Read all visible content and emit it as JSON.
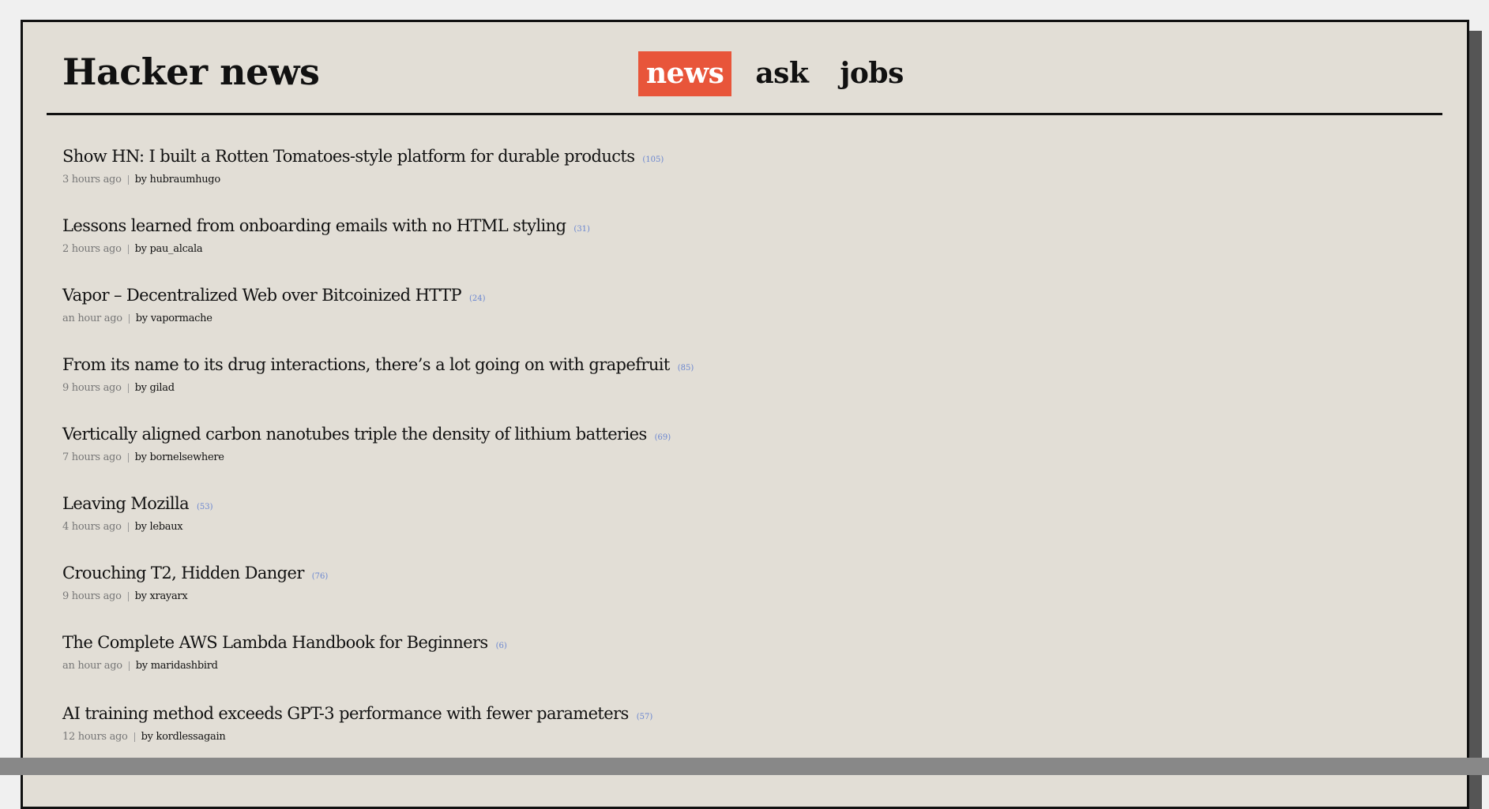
{
  "header": {
    "brand": "Hacker news",
    "nav": [
      {
        "label": "news",
        "active": true
      },
      {
        "label": "ask",
        "active": false
      },
      {
        "label": "jobs",
        "active": false
      }
    ]
  },
  "stories": [
    {
      "title": "Show HN: I built a Rotten Tomatoes-style platform for durable products",
      "comments": "(105)",
      "age": "3 hours ago",
      "by": "by",
      "author": "hubraumhugo"
    },
    {
      "title": "Lessons learned from onboarding emails with no HTML styling",
      "comments": "(31)",
      "age": "2 hours ago",
      "by": "by",
      "author": "pau_alcala"
    },
    {
      "title": "Vapor – Decentralized Web over Bitcoinized HTTP",
      "comments": "(24)",
      "age": "an hour ago",
      "by": "by",
      "author": "vapormache"
    },
    {
      "title": "From its name to its drug interactions, there’s a lot going on with grapefruit",
      "comments": "(85)",
      "age": "9 hours ago",
      "by": "by",
      "author": "gilad"
    },
    {
      "title": "Vertically aligned carbon nanotubes triple the density of lithium batteries",
      "comments": "(69)",
      "age": "7 hours ago",
      "by": "by",
      "author": "bornelsewhere"
    },
    {
      "title": "Leaving Mozilla",
      "comments": "(53)",
      "age": "4 hours ago",
      "by": "by",
      "author": "lebaux"
    },
    {
      "title": "Crouching T2, Hidden Danger",
      "comments": "(76)",
      "age": "9 hours ago",
      "by": "by",
      "author": "xrayarx"
    },
    {
      "title": "The Complete AWS Lambda Handbook for Beginners",
      "comments": "(6)",
      "age": "an hour ago",
      "by": "by",
      "author": "maridashbird"
    },
    {
      "title": "AI training method exceeds GPT-3 performance with fewer parameters",
      "comments": "(57)",
      "age": "12 hours ago",
      "by": "by",
      "author": "kordlessagain"
    }
  ],
  "colors": {
    "accent": "#e8553a",
    "background": "#e2ded6",
    "comments": "#6a86d0"
  }
}
